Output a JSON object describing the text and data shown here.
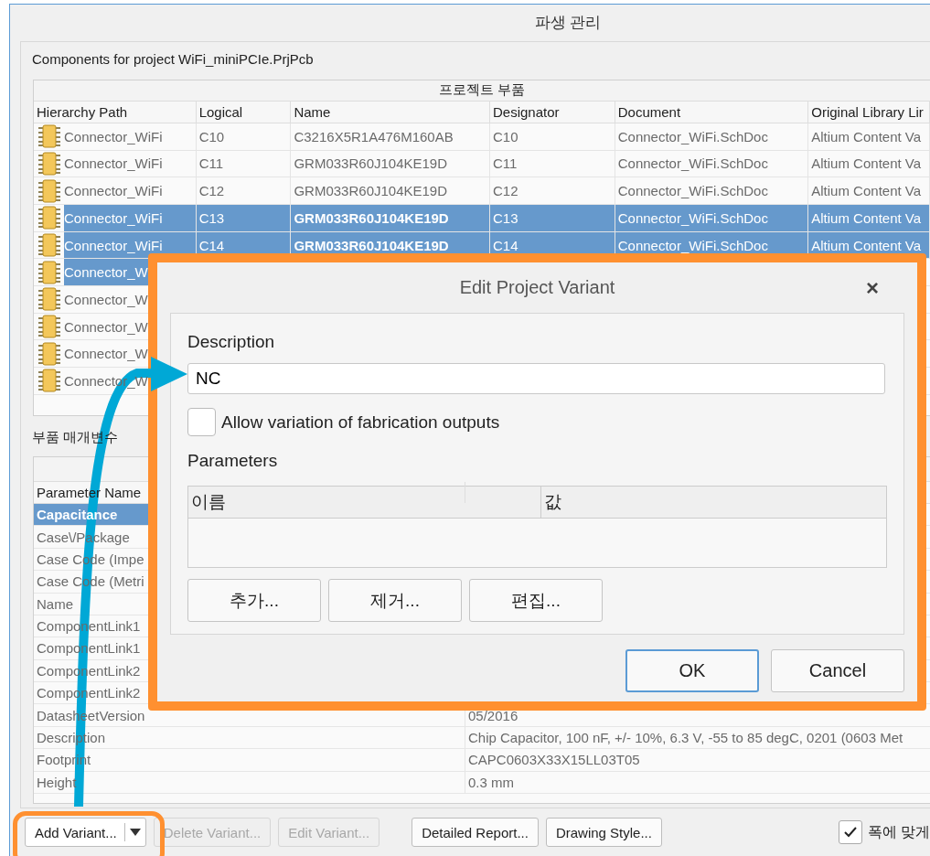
{
  "window": {
    "title": "파생 관리"
  },
  "project_label": "Components for project WiFi_miniPCIe.PrjPcb",
  "components_table": {
    "group_title": "프로젝트 부품",
    "columns": [
      "Hierarchy Path",
      "Logical",
      "Name",
      "Designator",
      "Document",
      "Original Library Lir"
    ],
    "rows": [
      {
        "cells": [
          "Connector_WiFi",
          "C10",
          "C3216X5R1A476M160AB",
          "C10",
          "Connector_WiFi.SchDoc",
          "Altium Content Va"
        ],
        "selected": false
      },
      {
        "cells": [
          "Connector_WiFi",
          "C11",
          "GRM033R60J104KE19D",
          "C11",
          "Connector_WiFi.SchDoc",
          "Altium Content Va"
        ],
        "selected": false
      },
      {
        "cells": [
          "Connector_WiFi",
          "C12",
          "GRM033R60J104KE19D",
          "C12",
          "Connector_WiFi.SchDoc",
          "Altium Content Va"
        ],
        "selected": false
      },
      {
        "cells": [
          "Connector_WiFi",
          "C13",
          "GRM033R60J104KE19D",
          "C13",
          "Connector_WiFi.SchDoc",
          "Altium Content Va"
        ],
        "selected": true
      },
      {
        "cells": [
          "Connector_WiFi",
          "C14",
          "GRM033R60J104KE19D",
          "C14",
          "Connector_WiFi.SchDoc",
          "Altium Content Va"
        ],
        "selected": true
      },
      {
        "cells": [
          "Connector_W"
        ],
        "selected": true
      },
      {
        "cells": [
          "Connector_W"
        ],
        "selected": false
      },
      {
        "cells": [
          "Connector_W"
        ],
        "selected": false
      },
      {
        "cells": [
          "Connector_W"
        ],
        "selected": false
      },
      {
        "cells": [
          "Connector_W"
        ],
        "selected": false
      }
    ]
  },
  "parameters_label": "부품 매개변수",
  "parameters_table": {
    "columns": [
      "Parameter Name"
    ],
    "rows": [
      {
        "name": "Capacitance",
        "selected": true
      },
      {
        "name": "Case\\/Package",
        "selected": false
      },
      {
        "name": "Case Code (Impe",
        "selected": false
      },
      {
        "name": "Case Code (Metri",
        "selected": false
      },
      {
        "name": "Name",
        "selected": false
      },
      {
        "name": "ComponentLink1",
        "selected": false
      },
      {
        "name": "ComponentLink1",
        "selected": false
      },
      {
        "name": "ComponentLink2",
        "selected": false
      },
      {
        "name": "ComponentLink2",
        "selected": false
      },
      {
        "name": "DatasheetVersion",
        "value": "05/2016",
        "selected": false
      },
      {
        "name": "Description",
        "value": "Chip Capacitor, 100 nF, +/- 10%, 6.3 V, -55 to 85 degC, 0201 (0603 Met",
        "selected": false
      },
      {
        "name": "Footprint",
        "value": "CAPC0603X33X15LL03T05",
        "selected": false
      },
      {
        "name": "Height",
        "value": "0.3 mm",
        "selected": false
      }
    ]
  },
  "dialog": {
    "title": "Edit Project Variant",
    "close": "×",
    "description_label": "Description",
    "description_value": "NC",
    "allow_variation": {
      "label": "Allow variation of fabrication outputs",
      "checked": false
    },
    "parameters_label": "Parameters",
    "parameter_columns": [
      "이름",
      "값"
    ],
    "table_buttons": [
      "추가...",
      "제거...",
      "편집..."
    ],
    "buttons": [
      {
        "label": "OK",
        "focused": true
      },
      {
        "label": "Cancel",
        "focused": false
      }
    ]
  },
  "buttons": [
    {
      "label": "Add Variant...",
      "kind": "split",
      "disabled": false
    },
    {
      "label": "Delete Variant...",
      "kind": "plain",
      "disabled": true
    },
    {
      "label": "Edit Variant...",
      "kind": "plain",
      "disabled": true
    },
    {
      "label": "Detailed Report...",
      "kind": "plain",
      "disabled": false
    },
    {
      "label": "Drawing Style...",
      "kind": "plain",
      "disabled": false
    }
  ],
  "fit_width": {
    "label": "폭에 맞게",
    "checked": true
  }
}
